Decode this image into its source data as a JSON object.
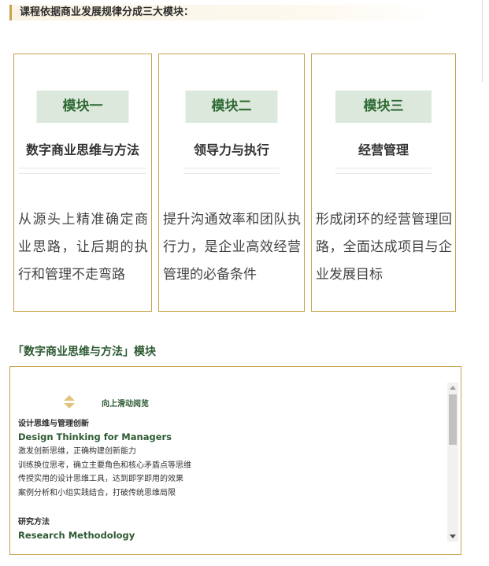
{
  "intro": {
    "text": "课程依据商业发展规律分成三大模块："
  },
  "modules": [
    {
      "badge": "模块一",
      "title": "数字商业思维与方法",
      "desc": "从源头上精准确定商业思路，让后期的执行和管理不走弯路"
    },
    {
      "badge": "模块二",
      "title": "领导力与执行",
      "desc": "提升沟通效率和团队执行力，是企业高效经营管理的必备条件"
    },
    {
      "badge": "模块三",
      "title": "经营管理",
      "desc": "形成闭环的经营管理回路，全面达成项目与企业发展目标"
    }
  ],
  "section": {
    "heading": "「数字商业思维与方法」模块"
  },
  "scroll": {
    "hint": "向上滑动阅览",
    "courses": [
      {
        "title_cn": "设计思维与管理创新",
        "title_en": "Design Thinking for Managers",
        "lines": [
          "激发创新思维，正确构建创新能力",
          "训练换位思考，确立主要角色和核心矛盾点等思维",
          "传授实用的设计思维工具，达到即学即用的效果",
          "案例分析和小组实践结合，打破传统思维局限"
        ]
      },
      {
        "title_cn": "研究方法",
        "title_en": "Research Methodology",
        "lines": []
      }
    ]
  },
  "colors": {
    "gold": "#c9a14a",
    "green": "#2f6b35",
    "badge_bg": "#dce8dc"
  }
}
